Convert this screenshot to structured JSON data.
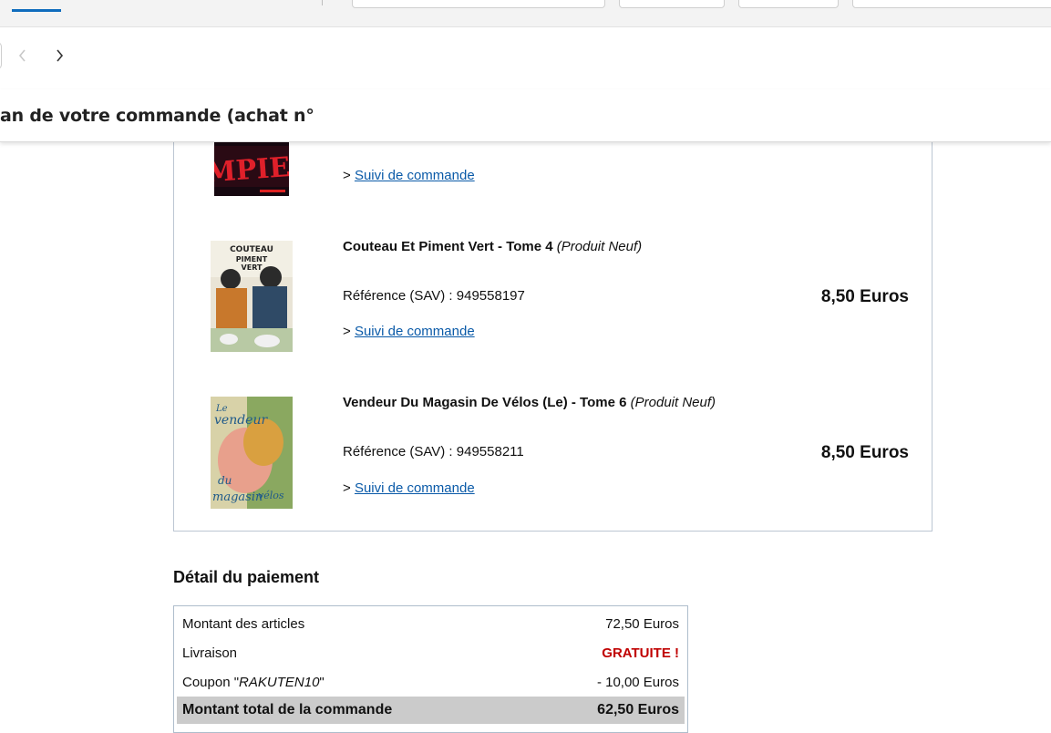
{
  "page": {
    "title": "an de votre commande (achat n°"
  },
  "order": {
    "items": [
      {
        "title": "",
        "condition": "",
        "reference_label": "",
        "reference": "",
        "price": "",
        "tracking_prefix": ">",
        "tracking_label": "Suivi de commande",
        "cover_text": "IMPIES"
      },
      {
        "title": "Couteau Et Piment Vert - Tome 4",
        "condition": "(Produit Neuf)",
        "reference_label": "Référence (SAV) : ",
        "reference": "949558197",
        "price": "8,50 Euros",
        "tracking_prefix": ">",
        "tracking_label": "Suivi de commande",
        "cover_text": "COUTEAU PIMENT VERT"
      },
      {
        "title": "Vendeur Du Magasin De Vélos (Le) - Tome 6",
        "condition": "(Produit Neuf)",
        "reference_label": "Référence (SAV) : ",
        "reference": "949558211",
        "price": "8,50 Euros",
        "tracking_prefix": ">",
        "tracking_label": "Suivi de commande",
        "cover_text": "le vendeur du magasin de vélos"
      }
    ]
  },
  "payment": {
    "heading": "Détail du paiement",
    "rows": [
      {
        "label": "Montant des articles",
        "value": "72,50 Euros"
      },
      {
        "label": "Livraison",
        "value": "GRATUITE !"
      },
      {
        "label_prefix": "Coupon \"",
        "coupon_code": "RAKUTEN10",
        "label_suffix": "\"",
        "value": "- 10,00 Euros"
      },
      {
        "label": "Montant total de la commande",
        "value": "62,50 Euros"
      }
    ]
  },
  "colors": {
    "link": "#0a5aa8",
    "free_shipping": "#c00000",
    "total_row_bg": "#cbcbcb",
    "active_tab": "#0f6cbd"
  },
  "icons": [
    "chevron-left-icon",
    "chevron-right-icon"
  ]
}
